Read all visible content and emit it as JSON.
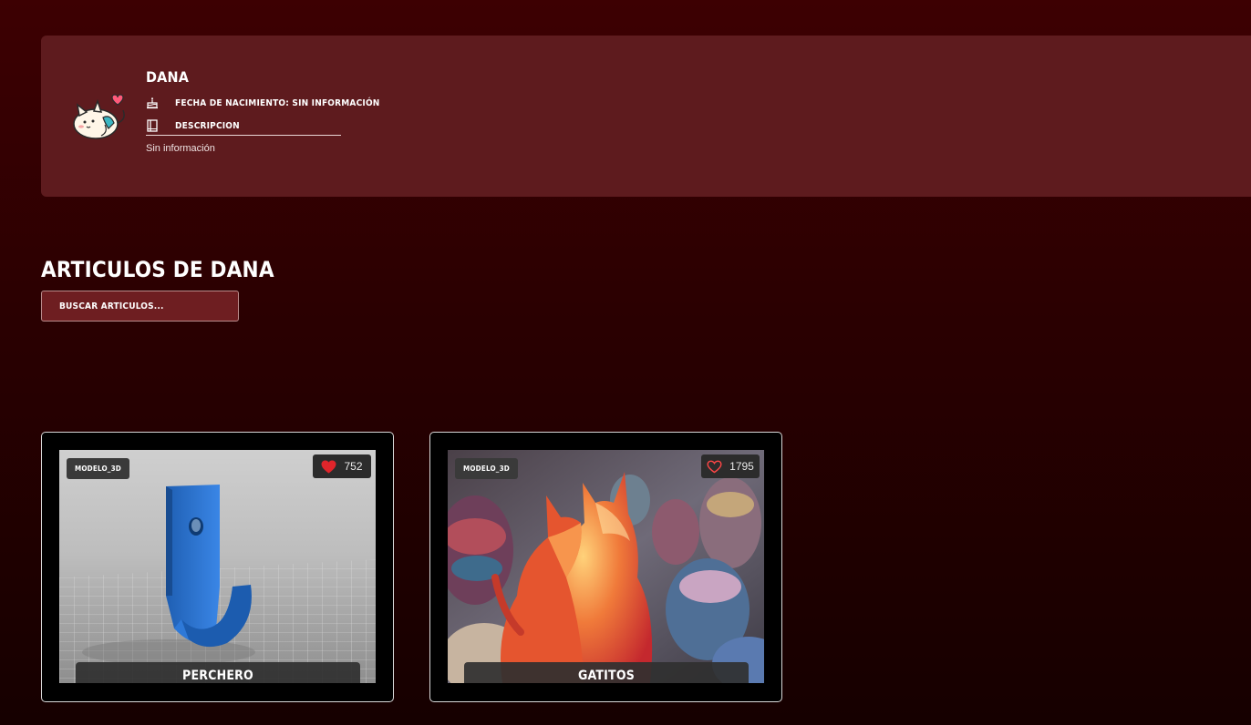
{
  "profile": {
    "name": "DANA",
    "birth_label": "FECHA DE NACIMIENTO: SIN INFORMACIÓN",
    "description_label": "DESCRIPCION",
    "description_value": "Sin información"
  },
  "articles": {
    "title": "ARTICULOS DE DANA",
    "search_placeholder": "BUSCAR ARTÍCULOS...",
    "items": [
      {
        "badge": "MODELO_3D",
        "likes": "752",
        "liked": true,
        "title": "PERCHERO"
      },
      {
        "badge": "MODELO_3D",
        "likes": "1795",
        "liked": false,
        "title": "GATITOS"
      }
    ]
  },
  "colors": {
    "background": "#2a0001",
    "profile_card": "#5e1b1e",
    "search_bg": "#6e1e21",
    "liked_heart": "#e0252b",
    "unliked_heart": "#ff4646"
  },
  "icons": {
    "avatar": "cat-avatar-icon",
    "birth": "cake-icon",
    "description": "book-icon",
    "liked": "heart-filled-icon",
    "unliked": "heart-outline-icon"
  }
}
